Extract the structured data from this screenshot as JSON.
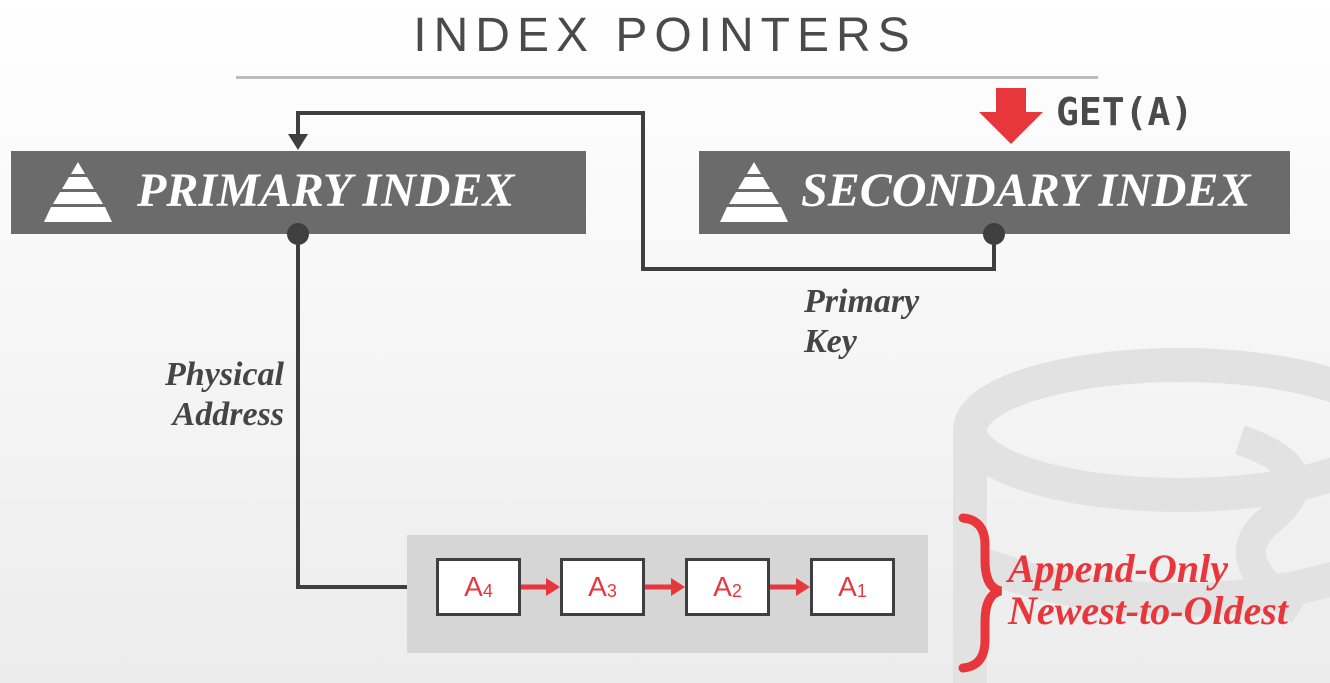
{
  "title": "INDEX POINTERS",
  "primary_index": {
    "label": "PRIMARY INDEX",
    "icon": "pyramid-icon"
  },
  "secondary_index": {
    "label": "SECONDARY INDEX",
    "icon": "pyramid-icon"
  },
  "query": {
    "label": "GET(A)",
    "arrow_color": "#e8373c"
  },
  "edge_labels": {
    "primary_key_line1": "Primary",
    "primary_key_line2": "Key",
    "physical_address_line1": "Physical",
    "physical_address_line2": "Address"
  },
  "version_chain": [
    {
      "base": "A",
      "sub": "4"
    },
    {
      "base": "A",
      "sub": "3"
    },
    {
      "base": "A",
      "sub": "2"
    },
    {
      "base": "A",
      "sub": "1"
    }
  ],
  "annotation": {
    "line1": "Append-Only",
    "line2": "Newest-to-Oldest"
  },
  "colors": {
    "accent": "#e8373c",
    "box": "#6b6b6b",
    "line": "#3f3f3f",
    "chain_bg": "#d6d6d6"
  }
}
